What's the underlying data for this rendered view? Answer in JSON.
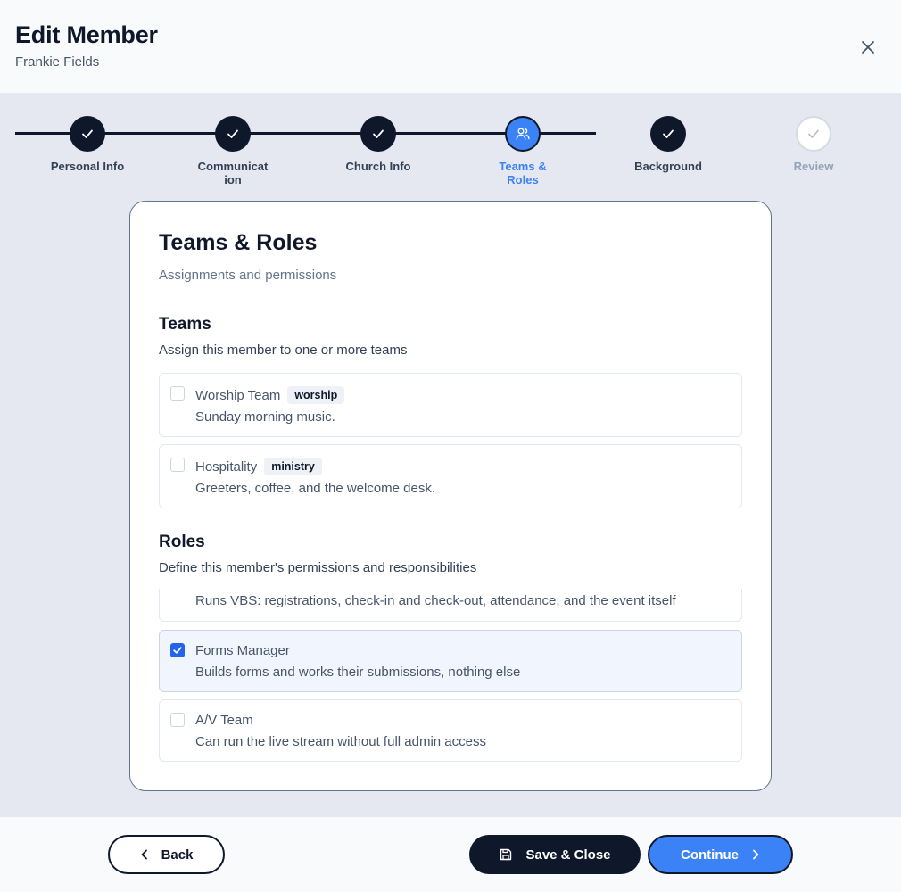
{
  "header": {
    "title": "Edit Member",
    "subtitle": "Frankie Fields"
  },
  "stepper": {
    "steps": [
      {
        "label": "Personal Info",
        "state": "complete"
      },
      {
        "label": "Communicat ion",
        "state": "complete"
      },
      {
        "label": "Church Info",
        "state": "complete"
      },
      {
        "label": "Teams & Roles",
        "state": "active"
      },
      {
        "label": "Background",
        "state": "complete"
      },
      {
        "label": "Review",
        "state": "pending"
      }
    ]
  },
  "card": {
    "title": "Teams & Roles",
    "subtitle": "Assignments and permissions",
    "teams": {
      "title": "Teams",
      "subtitle": "Assign this member to one or more teams",
      "items": [
        {
          "name": "Worship Team",
          "tag": "worship",
          "desc": "Sunday morning music.",
          "checked": false
        },
        {
          "name": "Hospitality",
          "tag": "ministry",
          "desc": "Greeters, coffee, and the welcome desk.",
          "checked": false
        }
      ]
    },
    "roles": {
      "title": "Roles",
      "subtitle": "Define this member's permissions and responsibilities",
      "items": [
        {
          "name": "",
          "desc": "Runs VBS: registrations, check-in and check-out, attendance, and the event itself",
          "checked": false
        },
        {
          "name": "Forms Manager",
          "desc": "Builds forms and works their submissions, nothing else",
          "checked": true
        },
        {
          "name": "A/V Team",
          "desc": "Can run the live stream without full admin access",
          "checked": false
        }
      ]
    }
  },
  "footer": {
    "back_label": "Back",
    "save_label": "Save & Close",
    "continue_label": "Continue"
  },
  "colors": {
    "accent": "#3b82f6",
    "dark": "#0f172a",
    "checkbox_checked": "#2563eb",
    "background": "#e5e8f0"
  },
  "icons": {
    "close": "close-icon",
    "complete": "check-icon",
    "active": "users-icon",
    "back": "chevron-left-icon",
    "save": "save-icon",
    "continue": "chevron-right-icon"
  }
}
